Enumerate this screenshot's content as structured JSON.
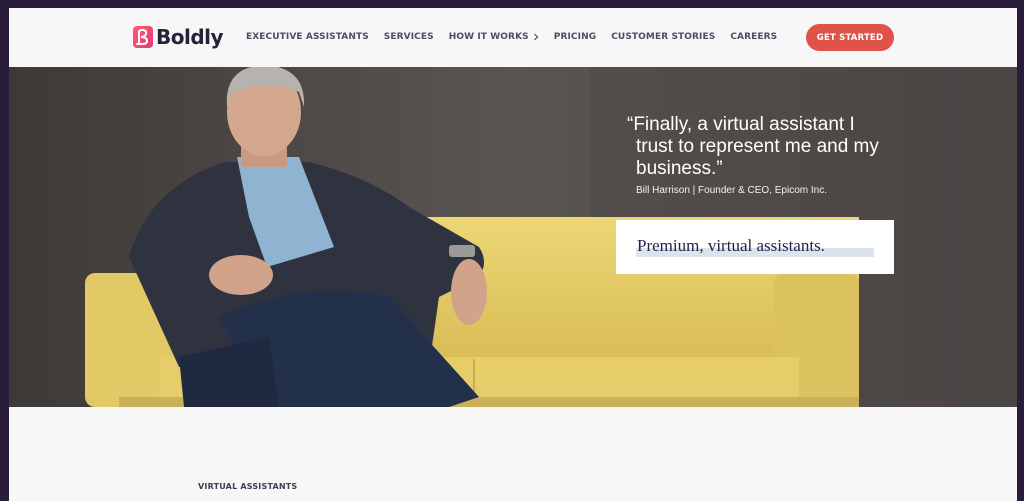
{
  "brand": {
    "name": "Boldly",
    "colors": {
      "accent": "#e1524a",
      "logo_gradient": [
        "#ff4f6d",
        "#e43b7a"
      ],
      "navy": "#25223a"
    }
  },
  "nav": {
    "items": [
      {
        "label": "EXECUTIVE ASSISTANTS"
      },
      {
        "label": "SERVICES"
      },
      {
        "label": "HOW IT WORKS",
        "icon": "chevron-right-icon"
      },
      {
        "label": "PRICING"
      },
      {
        "label": "CUSTOMER STORIES"
      },
      {
        "label": "CAREERS"
      }
    ],
    "cta_label": "GET STARTED"
  },
  "hero": {
    "quote_lines": [
      "“Finally, a virtual assistant I",
      "trust to represent me and my",
      "business.”"
    ],
    "attribution": "Bill Harrison | Founder & CEO, Epicom Inc.",
    "tagline": "Premium, virtual assistants.",
    "image": "man-in-blazer-on-yellow-sofa"
  },
  "section": {
    "label": "VIRTUAL ASSISTANTS"
  }
}
